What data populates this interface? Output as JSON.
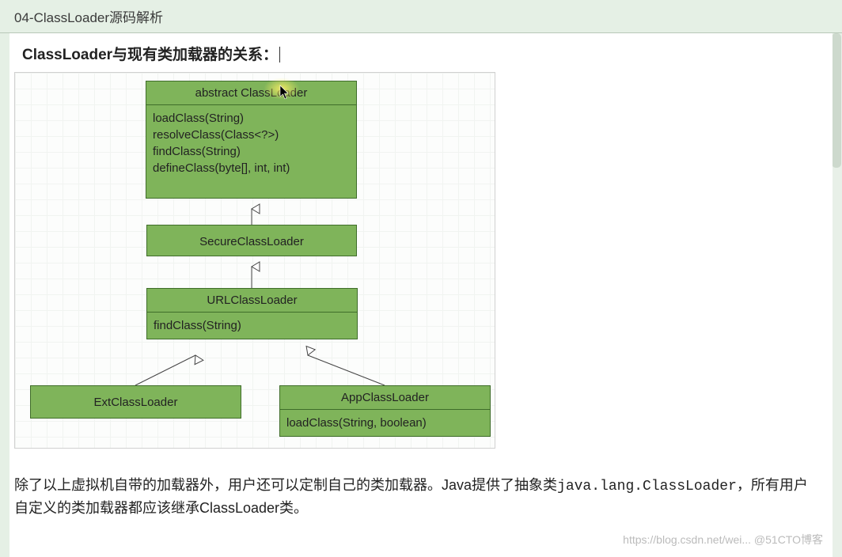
{
  "titlebar": "04-ClassLoader源码解析",
  "subtitle": "ClassLoader与现有类加载器的关系：",
  "diagram": {
    "abstract": {
      "title": "abstract ClassLoader",
      "methods": [
        "loadClass(String)",
        "resolveClass(Class<?>)",
        "findClass(String)",
        "defineClass(byte[], int, int)"
      ]
    },
    "secure": {
      "title": "SecureClassLoader"
    },
    "url": {
      "title": "URLClassLoader",
      "methods": [
        "findClass(String)"
      ]
    },
    "ext": {
      "title": "ExtClassLoader"
    },
    "app": {
      "title": "AppClassLoader",
      "methods": [
        "loadClass(String, boolean)"
      ]
    }
  },
  "paragraph": {
    "p1": "除了以上虚拟机自带的加载器外，用户还可以定制自己的类加载器。Java提供了抽象类",
    "code": "java.lang.ClassLoader",
    "p2": "，所有用户自定义的类加载器都应该继承ClassLoader类。"
  },
  "watermark": "https://blog.csdn.net/wei... @51CTO博客",
  "chart_data": {
    "type": "uml-class-diagram",
    "nodes": [
      {
        "id": "ClassLoader",
        "stereotype": "abstract",
        "methods": [
          "loadClass(String)",
          "resolveClass(Class<?>)",
          "findClass(String)",
          "defineClass(byte[], int, int)"
        ]
      },
      {
        "id": "SecureClassLoader",
        "methods": []
      },
      {
        "id": "URLClassLoader",
        "methods": [
          "findClass(String)"
        ]
      },
      {
        "id": "ExtClassLoader",
        "methods": []
      },
      {
        "id": "AppClassLoader",
        "methods": [
          "loadClass(String, boolean)"
        ]
      }
    ],
    "edges": [
      {
        "from": "SecureClassLoader",
        "to": "ClassLoader",
        "relation": "extends"
      },
      {
        "from": "URLClassLoader",
        "to": "SecureClassLoader",
        "relation": "extends"
      },
      {
        "from": "ExtClassLoader",
        "to": "URLClassLoader",
        "relation": "extends"
      },
      {
        "from": "AppClassLoader",
        "to": "URLClassLoader",
        "relation": "extends"
      }
    ]
  }
}
